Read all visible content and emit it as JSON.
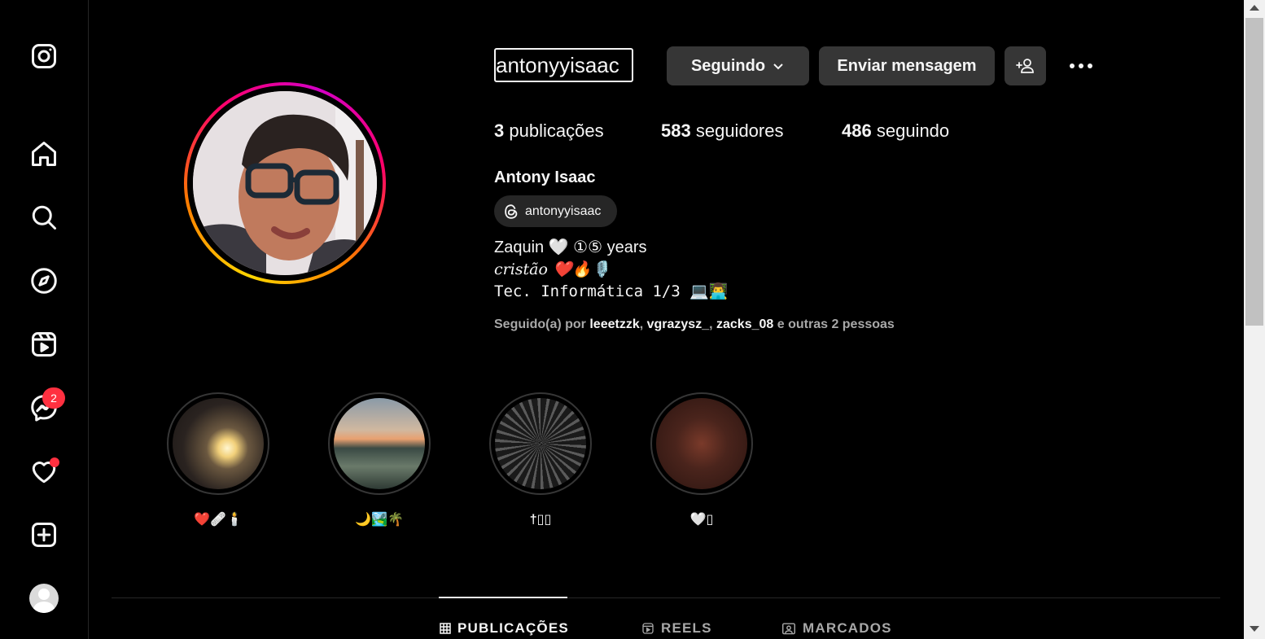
{
  "sidebar": {
    "logo": "instagram-icon",
    "items": [
      {
        "name": "home",
        "icon": "home-icon"
      },
      {
        "name": "search",
        "icon": "search-icon"
      },
      {
        "name": "explore",
        "icon": "compass-icon"
      },
      {
        "name": "reels",
        "icon": "reels-icon"
      },
      {
        "name": "messages",
        "icon": "messenger-icon",
        "badge": "2"
      },
      {
        "name": "notifications",
        "icon": "heart-icon",
        "dot": true
      },
      {
        "name": "create",
        "icon": "plus-square-icon"
      },
      {
        "name": "profile",
        "icon": "avatar"
      }
    ]
  },
  "profile": {
    "username": "antonyyisaac",
    "following_button": "Seguindo",
    "message_button": "Enviar mensagem",
    "stats": {
      "posts_count": "3",
      "posts_label": "publicações",
      "followers_count": "583",
      "followers_label": "seguidores",
      "following_count": "486",
      "following_label": "seguindo"
    },
    "full_name": "Antony Isaac",
    "threads_handle": "antonyyisaac",
    "bio_line1": "Zaquin 🤍 ①⑤ years",
    "bio_line2": "cristão ❤️🔥🎙️",
    "bio_line3": "Tec. Informática 1/3 💻👨‍💻",
    "followed_by_prefix": "Seguido(a) por",
    "followed_by_users": [
      "leeetzzk",
      "vgrazysz_",
      "zacks_08"
    ],
    "followed_by_suffix": "e outras 2 pessoas"
  },
  "highlights": [
    {
      "label": "❤️🩹🕯️"
    },
    {
      "label": "🌙🏞️🌴"
    },
    {
      "label": "†▯▯"
    },
    {
      "label": "🤍▯"
    }
  ],
  "tabs": [
    {
      "label": "PUBLICAÇÕES",
      "icon": "grid-icon",
      "active": true
    },
    {
      "label": "REELS",
      "icon": "reels-icon",
      "active": false
    },
    {
      "label": "MARCADOS",
      "icon": "tagged-icon",
      "active": false
    }
  ],
  "colors": {
    "background": "#000000",
    "button": "#363636",
    "badge": "#ff3040"
  }
}
